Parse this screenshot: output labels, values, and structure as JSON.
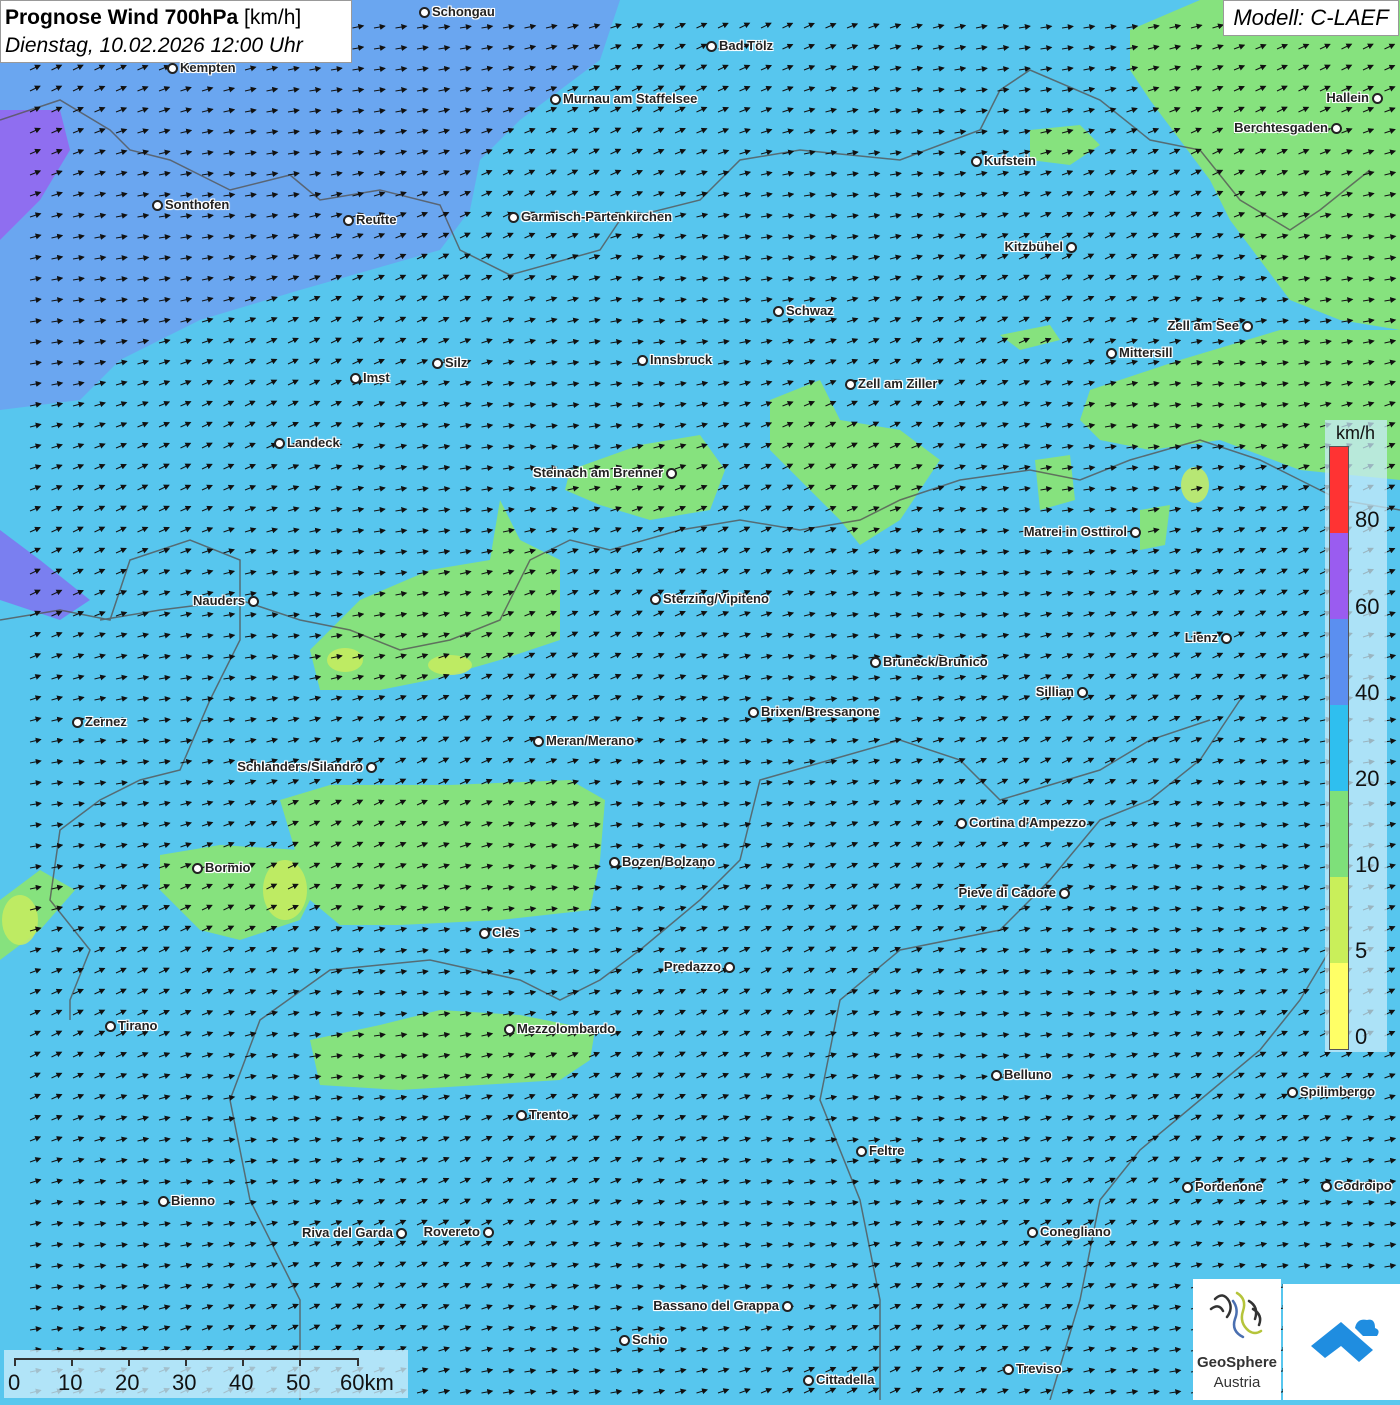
{
  "title": {
    "bold": "Prognose Wind 700hPa",
    "unit": "[km/h]",
    "date": "Dienstag, 10.02.2026 12:00 Uhr"
  },
  "model": "Modell: C-LAEF",
  "legend": {
    "unit": "km/h",
    "labels": [
      "80",
      "60",
      "40",
      "20",
      "10",
      "5",
      "0"
    ],
    "colors": [
      "#ff3333",
      "#9a5cf0",
      "#5b8ff0",
      "#2fbfef",
      "#7ee07a",
      "#c9ef5a",
      "#ffff66"
    ]
  },
  "scalebar": {
    "labels": [
      "0",
      "10",
      "20",
      "30",
      "40",
      "50",
      "60km"
    ]
  },
  "logos": {
    "geosphere_line1": "GeoSphere",
    "geosphere_line2": "Austria"
  },
  "cities": [
    "Schongau",
    "Bad Tölz",
    "Kempten",
    "Murnau am Staffelsee",
    "Hallein",
    "Berchtesgaden",
    "Kufstein",
    "Sonthofen",
    "Reutte",
    "Garmisch-Partenkirchen",
    "Kitzbühel",
    "Schwaz",
    "Zell am See",
    "Mittersill",
    "Innsbruck",
    "Imst",
    "Silz",
    "Zell am Ziller",
    "Landeck",
    "Steinach am Brenner",
    "Matrei in Osttirol",
    "Nauders",
    "Sterzing/Vipiteno",
    "Lienz",
    "Bruneck/Brunico",
    "Sillian",
    "Zernez",
    "Brixen/Bressanone",
    "Meran/Merano",
    "Schlanders/Silandro",
    "Cortina d'Ampezzo",
    "Bozen/Bolzano",
    "Bormio",
    "Pieve di Cadore",
    "Cles",
    "Predazzo",
    "Tirano",
    "Mezzolombardo",
    "Belluno",
    "Spilimbergo",
    "Trento",
    "Feltre",
    "Pordenone",
    "Codroipo",
    "Bienno",
    "Riva del Garda",
    "Rovereto",
    "Conegliano",
    "Bassano del Grappa",
    "Schio",
    "Treviso",
    "Cittadella"
  ]
}
